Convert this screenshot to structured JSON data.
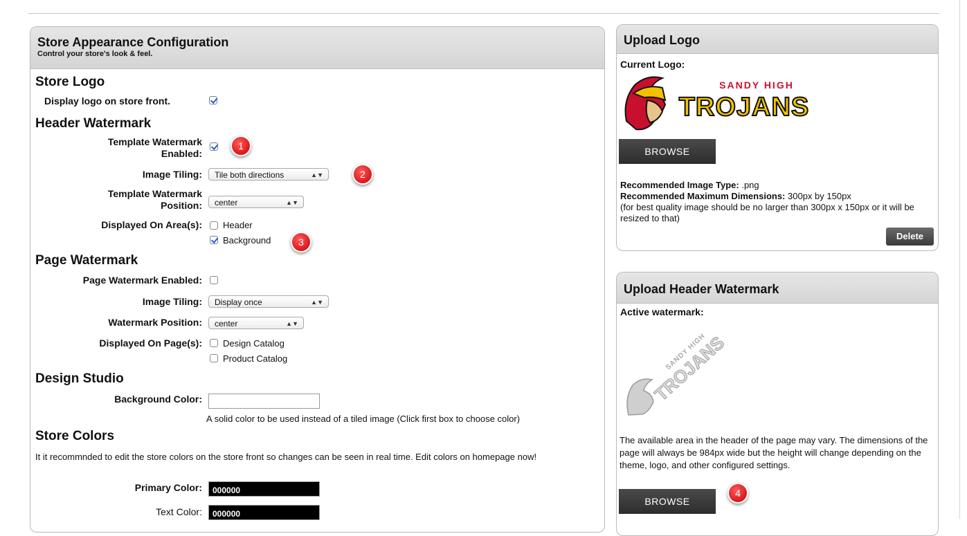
{
  "appearance": {
    "title": "Store Appearance Configuration",
    "subtitle": "Control your store's look & feel.",
    "store_logo": {
      "heading": "Store Logo",
      "display_label": "Display logo on store front.",
      "display_checked": true
    },
    "header_watermark": {
      "heading": "Header Watermark",
      "enabled_label_line1": "Template Watermark",
      "enabled_label_line2": "Enabled:",
      "enabled_checked": true,
      "tiling_label": "Image Tiling:",
      "tiling_value": "Tile both directions",
      "position_label_line1": "Template Watermark",
      "position_label_line2": "Position:",
      "position_value": "center",
      "areas_label": "Displayed On Area(s):",
      "areas": [
        {
          "label": "Header",
          "checked": false
        },
        {
          "label": "Background",
          "checked": true
        }
      ]
    },
    "page_watermark": {
      "heading": "Page Watermark",
      "enabled_label": "Page Watermark Enabled:",
      "enabled_checked": false,
      "tiling_label": "Image Tiling:",
      "tiling_value": "Display once",
      "position_label": "Watermark Position:",
      "position_value": "center",
      "pages_label": "Displayed On Page(s):",
      "pages": [
        {
          "label": "Design Catalog",
          "checked": false
        },
        {
          "label": "Product Catalog",
          "checked": false
        }
      ]
    },
    "design_studio": {
      "heading": "Design Studio",
      "bg_label": "Background Color:",
      "bg_value": "",
      "bg_help": "A solid color to be used instead of a tiled image (Click first box to choose color)"
    },
    "store_colors": {
      "heading": "Store Colors",
      "note": "It it recommnded to edit the store colors on the store front so changes can be seen in real time. Edit colors on homepage now!",
      "primary_label": "Primary Color:",
      "primary_value": "000000",
      "text_label": "Text Color:",
      "text_value": "000000"
    }
  },
  "upload_logo": {
    "title": "Upload Logo",
    "current_label": "Current Logo:",
    "logo_text_top": "SANDY HIGH",
    "logo_text_main": "TROJANS",
    "browse_label": "BROWSE",
    "type_label": "Recommended Image Type:",
    "type_value": ".png",
    "dims_label": "Recommended Maximum Dimensions:",
    "dims_value": "300px by 150px",
    "note": "(for best quality image should be no larger than 300px x 150px or it will be resized to that)",
    "delete_label": "Delete"
  },
  "upload_watermark": {
    "title": "Upload Header Watermark",
    "active_label": "Active watermark:",
    "wm_text_top": "SANDY HIGH",
    "wm_text_main": "TROJANS",
    "description": "The available area in the header of the page may vary. The dimensions of the page will always be 984px wide but the height will change depending on the theme, logo, and other configured settings.",
    "browse_label": "BROWSE"
  },
  "callouts": [
    "1",
    "2",
    "3",
    "4"
  ],
  "colors": {
    "badge": "#d8191c",
    "logo_red": "#c8102e",
    "logo_gold": "#f2c200"
  }
}
